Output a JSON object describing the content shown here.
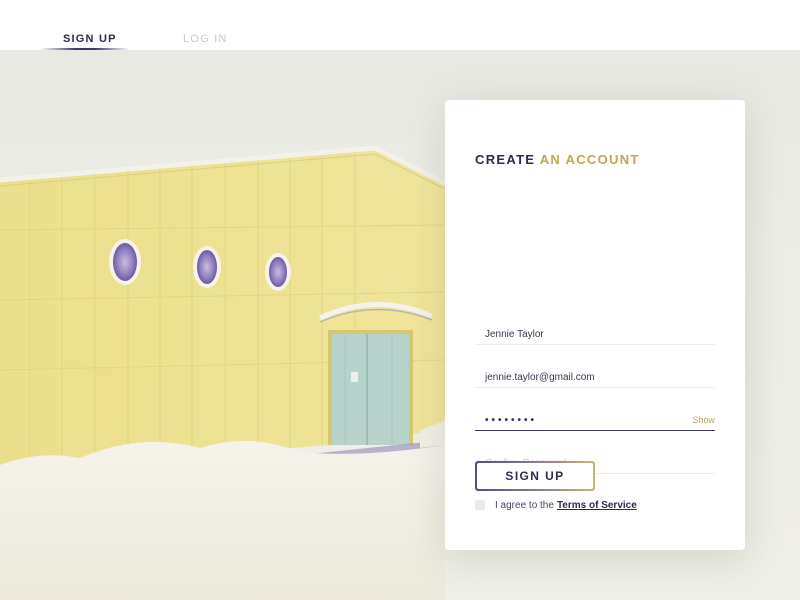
{
  "nav": {
    "tabs": [
      {
        "label": "SIGN UP",
        "active": true
      },
      {
        "label": "LOG IN",
        "active": false
      }
    ]
  },
  "form": {
    "title_part1": "CREATE",
    "title_part2": "AN ACCOUNT",
    "name_value": "Jennie Taylor",
    "email_value": "jennie.taylor@gmail.com",
    "password_value": "••••••••",
    "show_label": "Show",
    "confirm_placeholder": "Confirm Password",
    "agree_text": "I agree to the",
    "terms_label": "Terms of Service",
    "submit_label": "SIGN UP"
  },
  "colors": {
    "primary": "#2f2b4b",
    "accent_gold": "#c0a650",
    "accent_purple": "#5a4a86"
  }
}
